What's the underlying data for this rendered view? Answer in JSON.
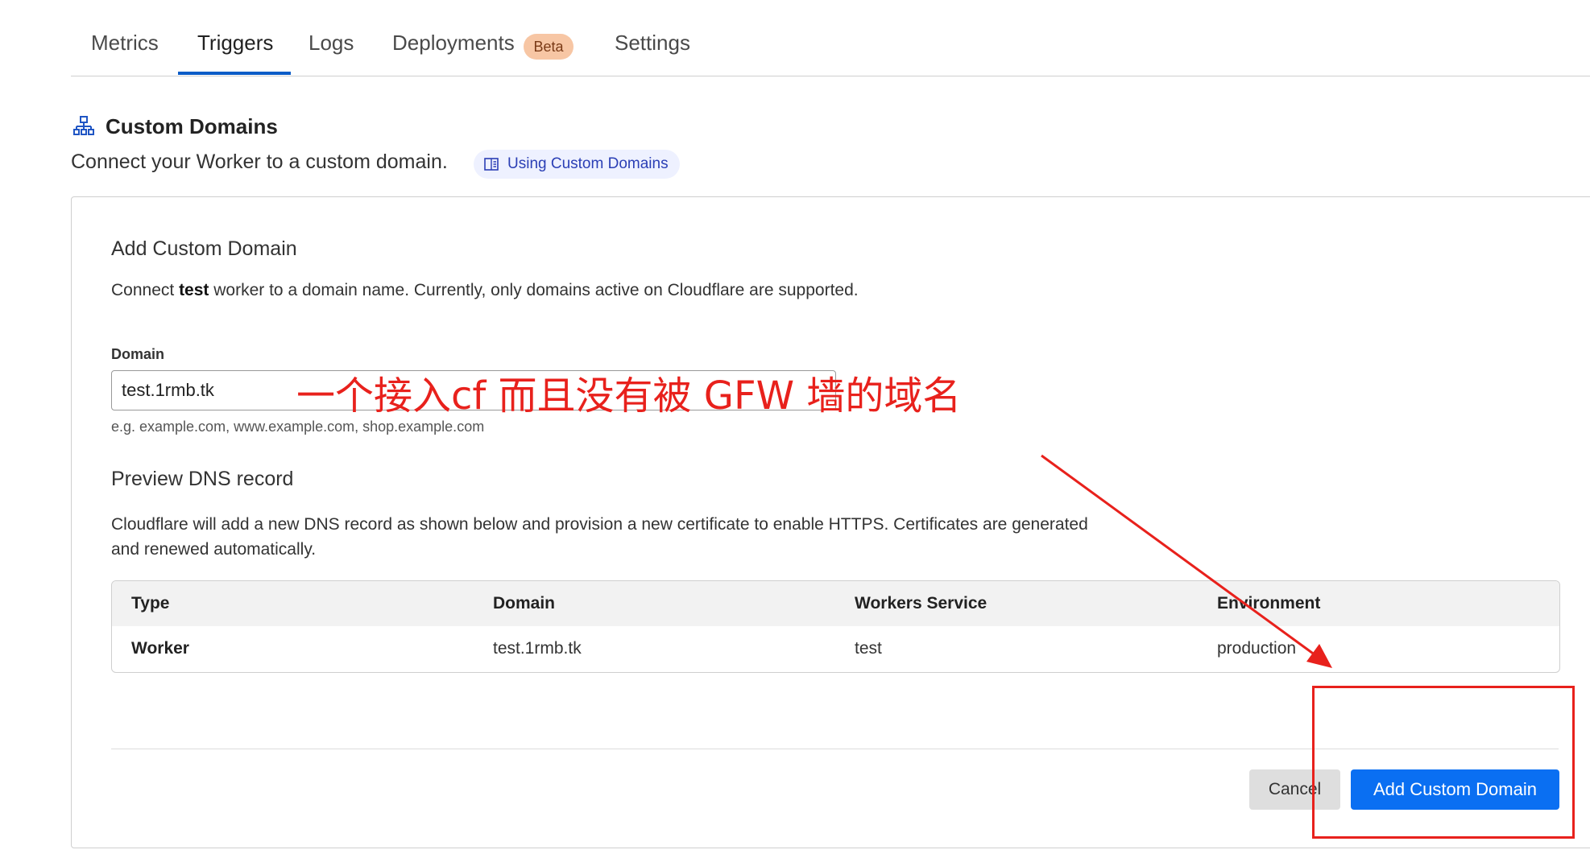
{
  "tabs": [
    {
      "label": "Metrics"
    },
    {
      "label": "Triggers",
      "active": true
    },
    {
      "label": "Logs"
    },
    {
      "label": "Deployments",
      "badge": "Beta"
    },
    {
      "label": "Settings"
    }
  ],
  "section": {
    "icon": "sitemap-icon",
    "title": "Custom Domains",
    "description": "Connect your Worker to a custom domain.",
    "doc_link": {
      "icon": "book-icon",
      "label": "Using Custom Domains"
    }
  },
  "card": {
    "title": "Add Custom Domain",
    "desc_prefix": "Connect ",
    "desc_worker": "test",
    "desc_suffix": " worker to a domain name. Currently, only domains active on Cloudflare are supported.",
    "domain_field": {
      "label": "Domain",
      "value": "test.1rmb.tk",
      "hint": "e.g. example.com, www.example.com, shop.example.com"
    },
    "preview": {
      "title": "Preview DNS record",
      "description": "Cloudflare will add a new DNS record as shown below and provision a new certificate to enable HTTPS. Certificates are generated and renewed automatically.",
      "columns": [
        "Type",
        "Domain",
        "Workers Service",
        "Environment"
      ],
      "rows": [
        [
          "Worker",
          "test.1rmb.tk",
          "test",
          "production"
        ]
      ]
    },
    "buttons": {
      "cancel": "Cancel",
      "add": "Add Custom Domain"
    }
  },
  "annotation": {
    "text": "一个接入cf 而且没有被 GFW 墙的域名",
    "color": "#e8211c"
  },
  "colors": {
    "accent": "#0a6ff2",
    "tab_underline": "#0a5cc7",
    "badge_bg": "#f7c6a4",
    "pill_bg": "#eef1ff"
  }
}
